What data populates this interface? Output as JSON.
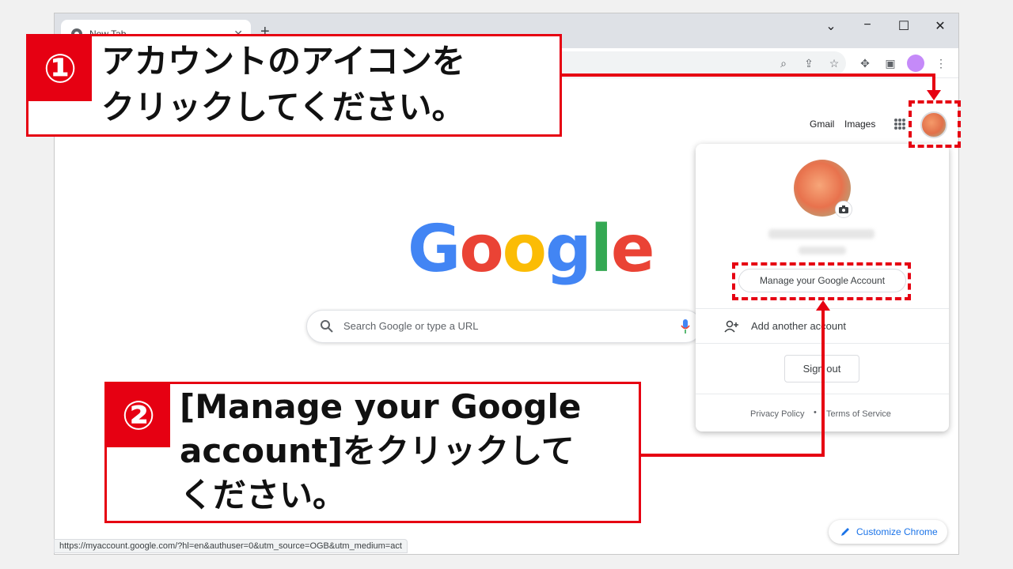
{
  "browser": {
    "tab_title": "New Tab",
    "new_tab_symbol": "+",
    "tab_close_symbol": "✕",
    "window_controls": {
      "minimize": "−",
      "maximize": "☐",
      "close": "✕"
    },
    "toolbar_icons": [
      "zoom-icon",
      "share-icon",
      "bookmark-star-icon",
      "extensions-icon",
      "side-panel-icon",
      "profile-icon",
      "menu-icon"
    ]
  },
  "page": {
    "top_links": {
      "gmail": "Gmail",
      "images": "Images"
    },
    "search_placeholder": "Search Google or type a URL",
    "logo_letters": [
      {
        "ch": "G",
        "color": "#4285f4"
      },
      {
        "ch": "o",
        "color": "#ea4335"
      },
      {
        "ch": "o",
        "color": "#fbbc05"
      },
      {
        "ch": "g",
        "color": "#4285f4"
      },
      {
        "ch": "l",
        "color": "#34a853"
      },
      {
        "ch": "e",
        "color": "#ea4335"
      }
    ],
    "customize_label": "Customize Chrome"
  },
  "account_panel": {
    "manage_label": "Manage your Google Account",
    "add_account_label": "Add another account",
    "sign_out_label": "Sign out",
    "privacy_label": "Privacy Policy",
    "dot": "•",
    "terms_label": "Terms of Service"
  },
  "status_bar": {
    "url": "https://myaccount.google.com/?hl=en&authuser=0&utm_source=OGB&utm_medium=act"
  },
  "annotations": {
    "step1": {
      "number": "①",
      "line1": "アカウントのアイコンを",
      "line2": "クリックしてください。"
    },
    "step2": {
      "number": "②",
      "line1": "[Manage your Google",
      "line2": "account]をクリックして",
      "line3": "ください。"
    },
    "accent_color": "#e60012"
  }
}
